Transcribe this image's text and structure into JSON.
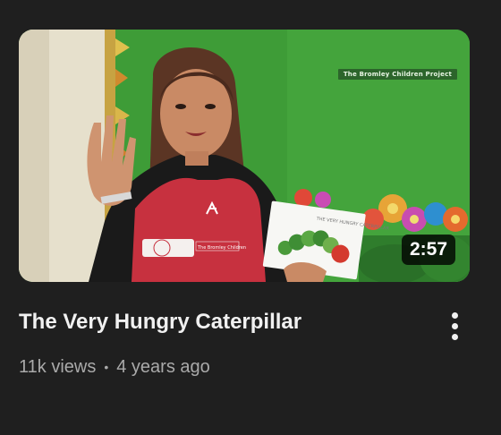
{
  "video": {
    "title": "The Very Hungry Caterpillar",
    "views": "11k views",
    "separator": "•",
    "age": "4 years ago",
    "duration": "2:57",
    "watermark": "The Bromley Children Project",
    "apron_text": "The Bromley Children",
    "book_title": "THE VERY HUNGRY CATERPILLAR"
  },
  "menu": {
    "icon": "more-vert-icon"
  },
  "colors": {
    "background": "#1f1f1f",
    "title": "#f1f1f1",
    "meta": "#aaaaaa",
    "duration_bg": "#000000"
  }
}
